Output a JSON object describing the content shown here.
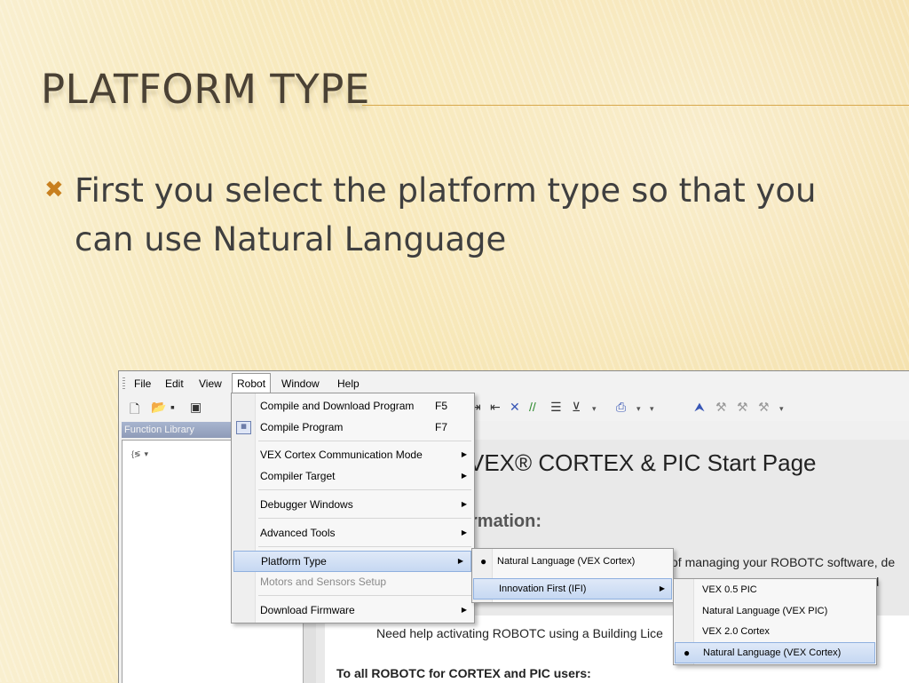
{
  "slide": {
    "title": "PLATFORM TYPE",
    "bullet_mark": "✖",
    "bullet_text": "First you select the platform type so that you can use Natural Language"
  },
  "menubar": {
    "items": [
      "File",
      "Edit",
      "View",
      "Robot",
      "Window",
      "Help"
    ],
    "open_item": "Robot"
  },
  "function_library": {
    "header": "Function Library",
    "tool_icon": "{≶",
    "dropdown_arrow": "▾"
  },
  "main": {
    "start_page_title": "VEX® CORTEX & PIC Start Page",
    "info_heading": "rmation:",
    "body_line1": "of managing your ROBOTC software, de",
    "body_line2": "s  and",
    "help_line": "Need help activating ROBOTC using a Building Lice",
    "cortex_line": "To all ROBOTC for CORTEX and PIC users:"
  },
  "robot_menu": {
    "compile_download": {
      "label": "Compile and Download Program",
      "shortcut": "F5"
    },
    "compile": {
      "label": "Compile Program",
      "shortcut": "F7"
    },
    "comm_mode": "VEX Cortex Communication Mode",
    "compiler_target": "Compiler Target",
    "debugger_windows": "Debugger Windows",
    "advanced_tools": "Advanced Tools",
    "platform_type": "Platform Type",
    "motors_sensors": "Motors and Sensors Setup",
    "download_firmware": "Download Firmware",
    "submenu_arrow": "▶"
  },
  "platform_submenu": {
    "natural_language_cortex": "Natural Language (VEX Cortex)",
    "innovation_first": "Innovation First (IFI)",
    "selected_dot": "●"
  },
  "ifi_submenu": {
    "vex05": "VEX 0.5 PIC",
    "nl_pic": "Natural Language (VEX PIC)",
    "vex20": "VEX 2.0 Cortex",
    "nl_cortex": "Natural Language (VEX Cortex)",
    "selected_dot": "●"
  }
}
